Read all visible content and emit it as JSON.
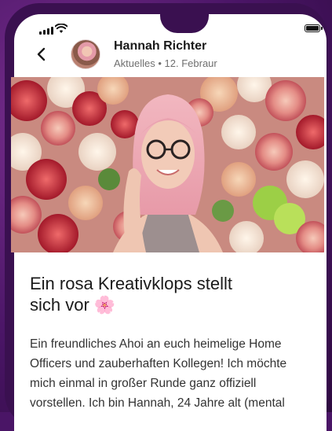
{
  "status_bar": {
    "signal_icon": "cellular-signal-icon",
    "wifi_icon": "wifi-icon",
    "battery_icon": "battery-icon"
  },
  "header": {
    "back_icon": "chevron-left-icon",
    "author": "Hannah Richter",
    "meta": "Aktuelles • 12. Febraur"
  },
  "post": {
    "image_alt": "Frau mit rosa Haaren und Brille vor einer Blumenwand",
    "title_line1": "Ein rosa Kreativklops stellt",
    "title_line2": "sich vor",
    "title_emoji": "🌸",
    "body_lines": [
      "Ein freundliches Ahoi an euch heimelige Home",
      "Officers und zauberhaften Kollegen! Ich möchte",
      "mich einmal in großer Runde ganz offiziell",
      "vorstellen. Ich bin Hannah, 24 Jahre alt (mental"
    ]
  },
  "colors": {
    "background": "#4a1566",
    "phone_frame": "#3a1050",
    "screen": "#ffffff",
    "text_primary": "#1a1a1a",
    "text_secondary": "#6f6f6f"
  }
}
